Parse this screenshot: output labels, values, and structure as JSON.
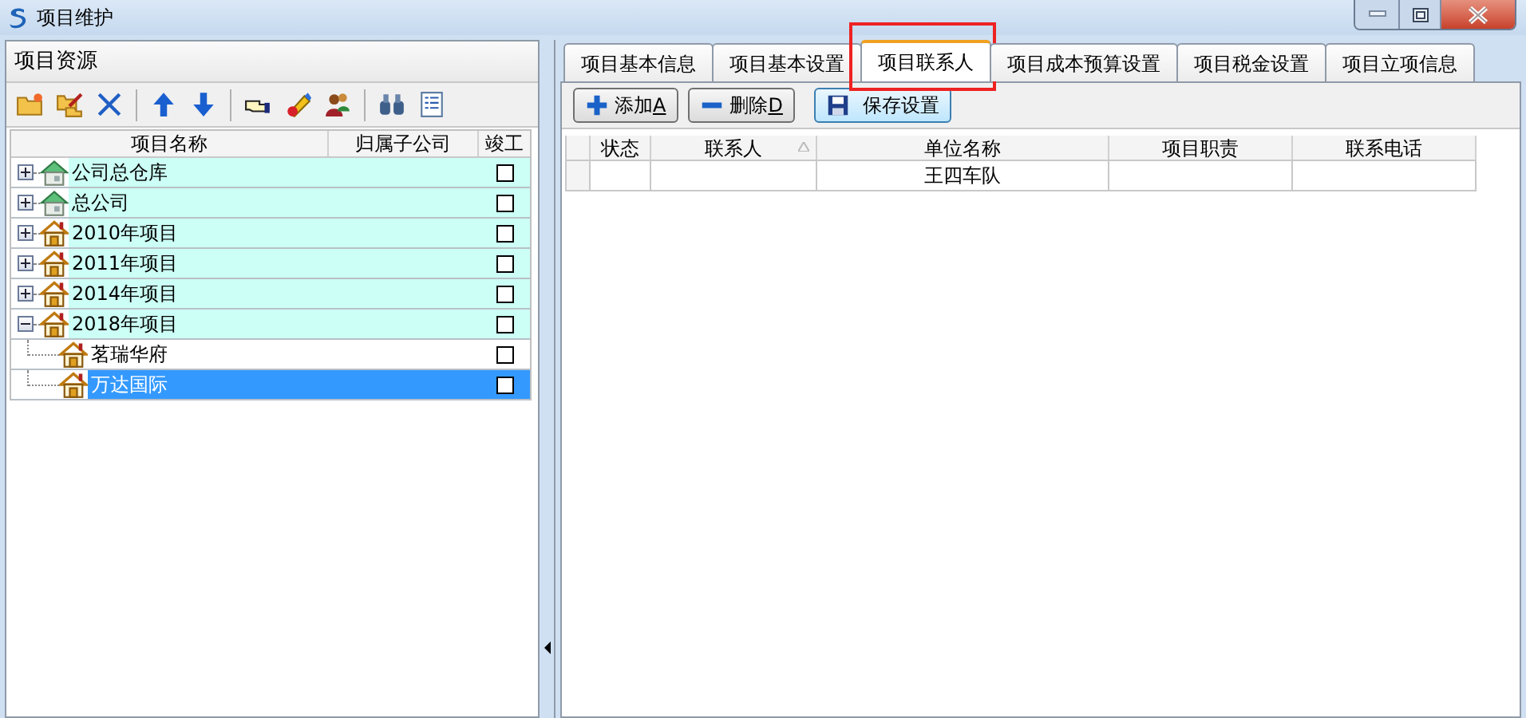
{
  "window": {
    "title": "项目维护"
  },
  "left_panel": {
    "title": "项目资源",
    "tree": {
      "columns": [
        "项目名称",
        "归属子公司",
        "竣工"
      ],
      "rows": [
        {
          "label": "公司总仓库",
          "kind": "company",
          "expanded": false,
          "checked": false,
          "selected": false
        },
        {
          "label": "总公司",
          "kind": "company",
          "expanded": false,
          "checked": false,
          "selected": false
        },
        {
          "label": "2010年项目",
          "kind": "project",
          "expanded": false,
          "checked": false,
          "selected": false
        },
        {
          "label": "2011年项目",
          "kind": "project",
          "expanded": false,
          "checked": false,
          "selected": false
        },
        {
          "label": "2014年项目",
          "kind": "project",
          "expanded": false,
          "checked": false,
          "selected": false
        },
        {
          "label": "2018年项目",
          "kind": "project",
          "expanded": true,
          "checked": false,
          "selected": false,
          "children": [
            {
              "label": "茗瑞华府",
              "kind": "project",
              "checked": false,
              "selected": false
            },
            {
              "label": "万达国际",
              "kind": "project",
              "checked": false,
              "selected": true
            }
          ]
        }
      ]
    }
  },
  "tabs": [
    {
      "label": "项目基本信息",
      "selected": false
    },
    {
      "label": "项目基本设置",
      "selected": false
    },
    {
      "label": "项目联系人",
      "selected": true,
      "highlighted": true
    },
    {
      "label": "项目成本预算设置",
      "selected": false
    },
    {
      "label": "项目税金设置",
      "selected": false
    },
    {
      "label": "项目立项信息",
      "selected": false
    }
  ],
  "buttons": [
    {
      "kind": "add",
      "label": "添加",
      "shortcut": "A"
    },
    {
      "kind": "remove",
      "label": "删除",
      "shortcut": "D"
    },
    {
      "kind": "save",
      "label": "保存设置"
    }
  ],
  "grid": {
    "columns": [
      "状态",
      "联系人",
      "单位名称",
      "项目职责",
      "联系电话"
    ],
    "rows": [
      [
        "",
        "",
        "王四车队",
        "",
        ""
      ]
    ]
  }
}
